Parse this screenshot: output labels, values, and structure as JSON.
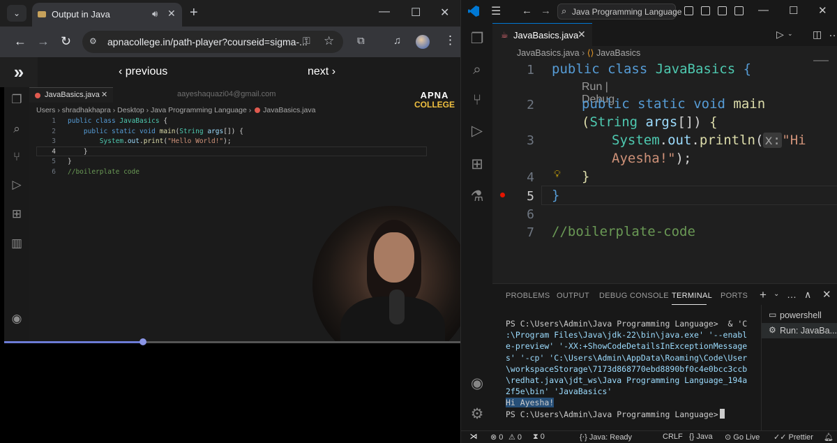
{
  "browser": {
    "tab_title": "Output in Java",
    "url": "apnacollege.in/path-player?courseid=sigma-...",
    "nav": {
      "previous": "‹ previous",
      "next": "next ›"
    }
  },
  "video": {
    "tab_name": "JavaBasics.java",
    "email": "aayeshaquazi04@gmail.com",
    "breadcrumb": [
      "Users",
      "shradhakhapra",
      "Desktop",
      "Java Programming Language",
      "JavaBasics.java"
    ],
    "logo_top": "APNA",
    "logo_bottom": "COLLEGE",
    "line_numbers": [
      "1",
      "2",
      "3",
      "4",
      "5",
      "6"
    ],
    "progress_percent": 30.5
  },
  "vscode": {
    "search": "Java Programming Language",
    "tab_name": "JavaBasics.java",
    "breadcrumb_file": "JavaBasics.java",
    "breadcrumb_class": "JavaBasics",
    "codelens": "Run | Debug",
    "line_numbers": [
      "1",
      "2",
      "3",
      "4",
      "5",
      "6",
      "7"
    ],
    "panel_tabs": [
      "PROBLEMS",
      "OUTPUT",
      "DEBUG CONSOLE",
      "TERMINAL",
      "PORTS"
    ],
    "active_panel_tab": "TERMINAL",
    "terminal_lines": [
      "PS C:\\Users\\Admin\\Java Programming Language>  & 'C",
      ":\\Program Files\\Java\\jdk-22\\bin\\java.exe' '--enabl",
      "e-preview' '-XX:+ShowCodeDetailsInExceptionMessage",
      "s' '-cp' 'C:\\Users\\Admin\\AppData\\Roaming\\Code\\User",
      "\\workspaceStorage\\7173d868770ebd8890bf0c4e0bcc3ccb",
      "\\redhat.java\\jdt_ws\\Java Programming Language_194a",
      "2f5e\\bin' 'JavaBasics'"
    ],
    "terminal_output": "Hi Ayesha!",
    "terminal_prompt": "PS C:\\Users\\Admin\\Java Programming Language>",
    "terminal_list": [
      "powershell",
      "Run: JavaBa..."
    ],
    "status": {
      "errors": "0",
      "warnings": "0",
      "ports": "0",
      "java": "Java: Ready",
      "eol": "CRLF",
      "language": "Java",
      "golive": "Go Live",
      "prettier": "Prettier"
    }
  }
}
